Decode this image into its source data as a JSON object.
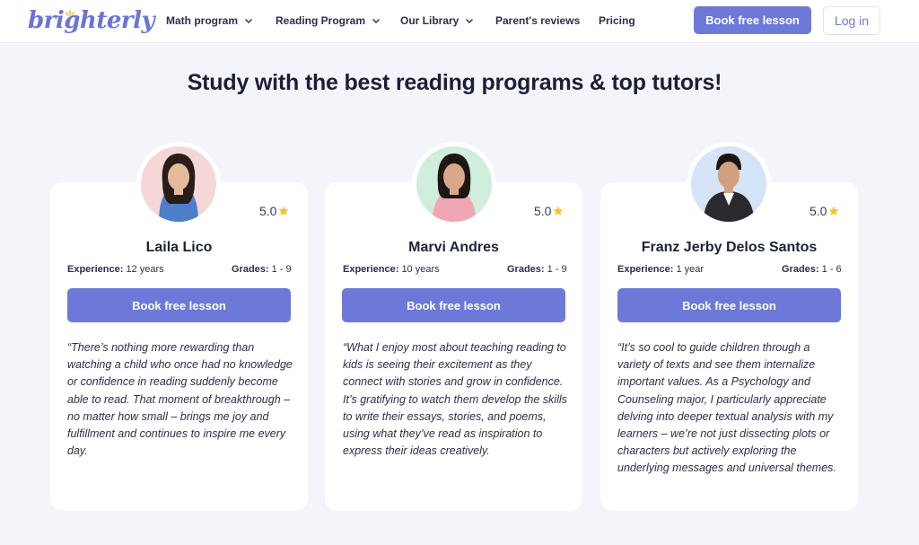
{
  "brand": {
    "logo_text": "brighterly",
    "color": "#6d79d9"
  },
  "nav": {
    "items": [
      {
        "label": "Math program",
        "has_dropdown": true
      },
      {
        "label": "Reading Program",
        "has_dropdown": true
      },
      {
        "label": "Our Library",
        "has_dropdown": true
      },
      {
        "label": "Parent's reviews",
        "has_dropdown": false
      },
      {
        "label": "Pricing",
        "has_dropdown": false
      }
    ],
    "book_label": "Book free lesson",
    "login_label": "Log in"
  },
  "page": {
    "title": "Study with the best reading programs & top tutors!"
  },
  "tutors": [
    {
      "name": "Laila Lico",
      "rating": "5.0",
      "experience_label": "Experience:",
      "experience": "12 years",
      "grades_label": "Grades:",
      "grades": "1 - 9",
      "button": "Book free lesson",
      "quote": "“There’s nothing more rewarding than watching a child who once had no knowledge or confidence in reading suddenly become able to read. That moment of breakthrough – no matter how small – brings me joy and fulfillment and continues to inspire me every day.",
      "avatar_bg": "#f6d7d7"
    },
    {
      "name": "Marvi Andres",
      "rating": "5.0",
      "experience_label": "Experience:",
      "experience": "10 years",
      "grades_label": "Grades:",
      "grades": "1 - 9",
      "button": "Book free lesson",
      "quote": "“What I enjoy most about teaching reading to kids is seeing their excitement as they connect with stories and grow in confidence. It’s gratifying to watch them develop the skills to write their essays, stories, and poems, using what they’ve read as inspiration to express their ideas creatively.",
      "avatar_bg": "#cfeedd"
    },
    {
      "name": "Franz Jerby Delos Santos",
      "rating": "5.0",
      "experience_label": "Experience:",
      "experience": "1 year",
      "grades_label": "Grades:",
      "grades": "1 - 6",
      "button": "Book free lesson",
      "quote": "“It’s so cool to guide children through a variety of texts and see them internalize important values. As a Psychology and Counseling major, I particularly appreciate delving into deeper textual analysis with my learners – we’re not just dissecting plots or characters but actively exploring the underlying messages and universal themes.",
      "avatar_bg": "#d6e4f7"
    }
  ],
  "icons": {
    "star": "star-icon",
    "chevron": "chevron-down-icon"
  },
  "colors": {
    "star": "#f5c02f",
    "accent": "#6d79d9",
    "background": "#f3f5fb"
  }
}
